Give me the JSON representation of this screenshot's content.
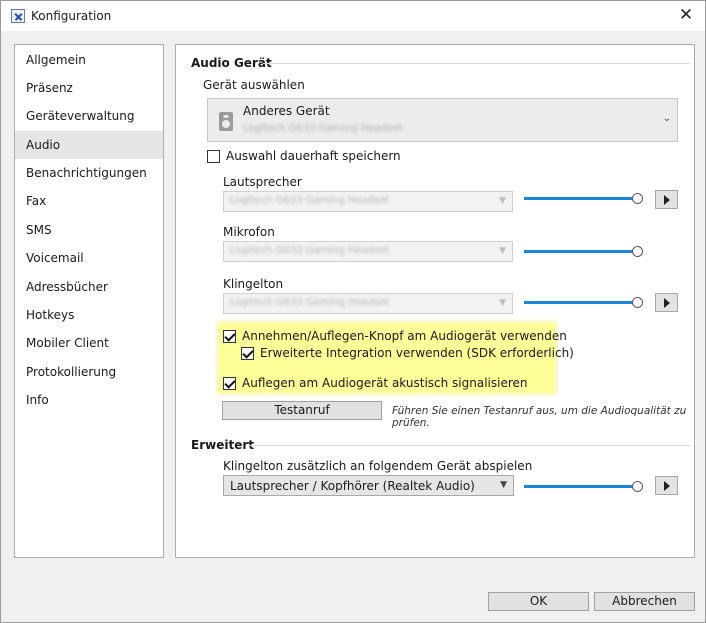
{
  "window": {
    "title": "Konfiguration"
  },
  "sidebar": {
    "items": [
      {
        "label": "Allgemein",
        "active": false
      },
      {
        "label": "Präsenz",
        "active": false
      },
      {
        "label": "Geräteverwaltung",
        "active": false
      },
      {
        "label": "Audio",
        "active": true
      },
      {
        "label": "Benachrichtigungen",
        "active": false
      },
      {
        "label": "Fax",
        "active": false
      },
      {
        "label": "SMS",
        "active": false
      },
      {
        "label": "Voicemail",
        "active": false
      },
      {
        "label": "Adressbücher",
        "active": false
      },
      {
        "label": "Hotkeys",
        "active": false
      },
      {
        "label": "Mobiler Client",
        "active": false
      },
      {
        "label": "Protokollierung",
        "active": false
      },
      {
        "label": "Info",
        "active": false
      }
    ]
  },
  "audio": {
    "section_title": "Audio Gerät",
    "device_select_label": "Gerät auswählen",
    "device": {
      "name": "Anderes Gerät",
      "subtitle": "Logitech G633 Gaming Headset",
      "icon": "speaker-icon"
    },
    "save_selection": {
      "label": "Auswahl dauerhaft speichern",
      "checked": false
    },
    "speaker": {
      "label": "Lautsprecher",
      "value": "Logitech G633 Gaming Headset",
      "volume": 100
    },
    "microphone": {
      "label": "Mikrofon",
      "value": "Logitech G633 Gaming Headset",
      "volume": 100
    },
    "ringtone": {
      "label": "Klingelton",
      "value": "Logitech G633 Gaming Headset",
      "volume": 100
    },
    "use_button": {
      "label": "Annehmen/Auflegen-Knopf am Audiogerät verwenden",
      "checked": true
    },
    "extended_integration": {
      "label": "Erweiterte Integration verwenden (SDK erforderlich)",
      "checked": true
    },
    "hangup_signal": {
      "label": "Auflegen am Audiogerät akustisch signalisieren",
      "checked": true
    },
    "test_call_button": "Testanruf",
    "test_call_hint": "Führen Sie einen Testanruf aus, um die Audioqualität zu prüfen."
  },
  "advanced": {
    "section_title": "Erweitert",
    "extra_ringtone_label": "Klingelton zusätzlich an folgendem Gerät abspielen",
    "extra_ringtone_device": "Lautsprecher / Kopfhörer (Realtek Audio)",
    "volume": 100
  },
  "footer": {
    "ok_label": "OK",
    "cancel_label": "Abbrechen"
  },
  "colors": {
    "accent": "#1a84d6",
    "highlight": "#ffff9a"
  }
}
